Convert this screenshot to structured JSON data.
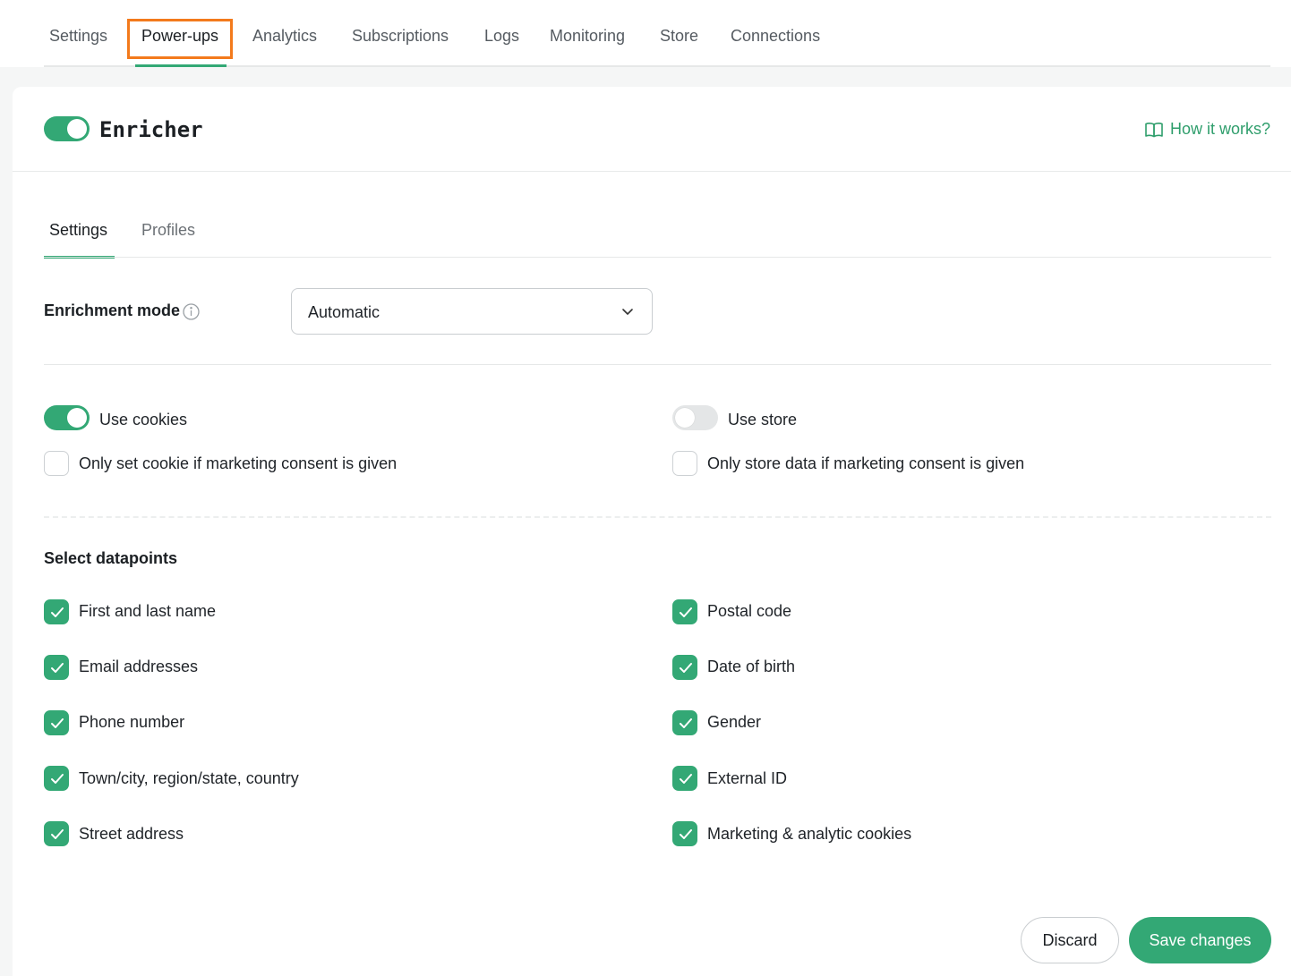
{
  "top_nav": {
    "tabs": [
      {
        "label": "Settings"
      },
      {
        "label": "Power-ups"
      },
      {
        "label": "Analytics"
      },
      {
        "label": "Subscriptions"
      },
      {
        "label": "Logs"
      },
      {
        "label": "Monitoring"
      },
      {
        "label": "Store"
      },
      {
        "label": "Connections"
      }
    ],
    "active": "Power-ups"
  },
  "header": {
    "title": "Enricher",
    "enabled": true,
    "help_link": "How it works?",
    "help_icon": "book-icon"
  },
  "sub_tabs": {
    "tabs": [
      {
        "label": "Settings"
      },
      {
        "label": "Profiles"
      }
    ],
    "active": "Settings"
  },
  "enrichment": {
    "label": "Enrichment mode",
    "value": "Automatic"
  },
  "options": {
    "cookies_label": "Use cookies",
    "cookies_enabled": true,
    "cookie_consent_label": "Only set cookie if marketing consent is given",
    "cookie_consent_checked": false,
    "store_label": "Use store",
    "store_enabled": false,
    "store_consent_label": "Only store data if marketing consent is given",
    "store_consent_checked": false
  },
  "datapoints": {
    "heading": "Select datapoints",
    "items": [
      {
        "label": "First and last name",
        "checked": true
      },
      {
        "label": "Email addresses",
        "checked": true
      },
      {
        "label": "Phone number",
        "checked": true
      },
      {
        "label": "Town/city, region/state, country",
        "checked": true
      },
      {
        "label": "Street address",
        "checked": true
      },
      {
        "label": "Postal code",
        "checked": true
      },
      {
        "label": "Date of birth",
        "checked": true
      },
      {
        "label": "Gender",
        "checked": true
      },
      {
        "label": "External ID",
        "checked": true
      },
      {
        "label": "Marketing & analytic cookies",
        "checked": true
      }
    ]
  },
  "actions": {
    "discard": "Discard",
    "save": "Save changes"
  },
  "colors": {
    "accent": "#33a875",
    "highlight": "#f37a1c"
  }
}
